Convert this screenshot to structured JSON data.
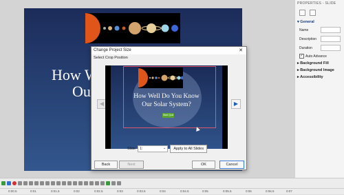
{
  "properties": {
    "title": "PROPERTIES - SLIDE",
    "sections": {
      "general": "General",
      "bg_fill": "Background Fill",
      "bg_image": "Background Image",
      "accessibility": "Accessibility"
    },
    "fields": {
      "name": "Name",
      "description": "Description",
      "duration": "Duration",
      "auto_advance": "Auto Advance"
    }
  },
  "slide": {
    "title_line1": "How W",
    "title_line2": "Ou"
  },
  "dialog": {
    "title": "Change Project Size",
    "close": "✕",
    "subtitle": "Select Crop Position",
    "preview_line1": "How Well Do You Know",
    "preview_line2": "Our Solar System?",
    "start_label": "Start Quiz",
    "slide_label": "Slide",
    "slide_value": "1:",
    "apply_all": "Apply to All Slides",
    "back": "Back",
    "next": "Next",
    "ok": "OK",
    "cancel": "Cancel"
  },
  "timeline": {
    "ticks": [
      "0:00.5",
      "0:01",
      "0:01.5",
      "0:02",
      "0:02.5",
      "0:03",
      "0:03.5",
      "0:04",
      "0:04.5",
      "0:05",
      "0:05.5",
      "0:06",
      "0:06.5",
      "0:07"
    ]
  },
  "colors": {
    "accent": "#1a5fb4",
    "crop": "#e0566b",
    "start": "#5aa632"
  }
}
